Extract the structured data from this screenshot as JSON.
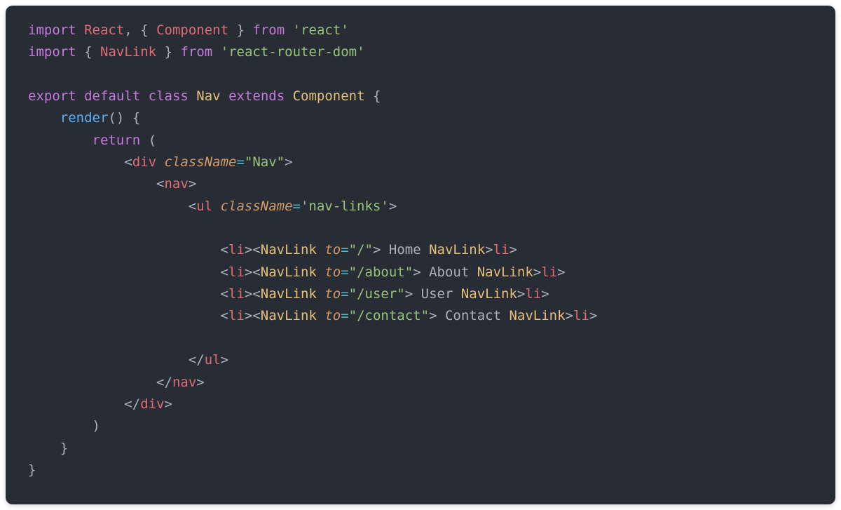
{
  "code": {
    "line1": {
      "import": "import",
      "react": "React",
      "comma": ",",
      "lbrace": "{",
      "component": "Component",
      "rbrace": "}",
      "from": "from",
      "pkg": "'react'"
    },
    "line2": {
      "import": "import",
      "lbrace": "{",
      "navlink": "NavLink",
      "rbrace": "}",
      "from": "from",
      "pkg": "'react-router-dom'"
    },
    "line4": {
      "export": "export",
      "default": "default",
      "class": "class",
      "nav": "Nav",
      "extends": "extends",
      "component": "Component",
      "brace": "{"
    },
    "line5": {
      "render": "render",
      "parens": "() {"
    },
    "line6": {
      "return": "return",
      "paren": "("
    },
    "line7": {
      "lt": "<",
      "div": "div",
      "className": "className",
      "eq": "=",
      "val": "\"Nav\"",
      "gt": ">"
    },
    "line8": {
      "lt": "<",
      "nav": "nav",
      "gt": ">"
    },
    "line9": {
      "lt": "<",
      "ul": "ul",
      "className": "className",
      "eq": "=",
      "val": "'nav-links'",
      "gt": ">"
    },
    "navItems": [
      {
        "to": "\"/\"",
        "label": " Home "
      },
      {
        "to": "\"/about\"",
        "label": " About "
      },
      {
        "to": "\"/user\"",
        "label": " User "
      },
      {
        "to": "\"/contact\"",
        "label": " Contact "
      }
    ],
    "tags": {
      "lt": "<",
      "gt": ">",
      "slash": "/",
      "li": "li",
      "navlink": "NavLink",
      "to": "to",
      "eq": "=",
      "ul": "ul",
      "nav": "nav",
      "div": "div"
    },
    "closers": {
      "paren": ")",
      "brace1": "}",
      "brace2": "}"
    }
  }
}
